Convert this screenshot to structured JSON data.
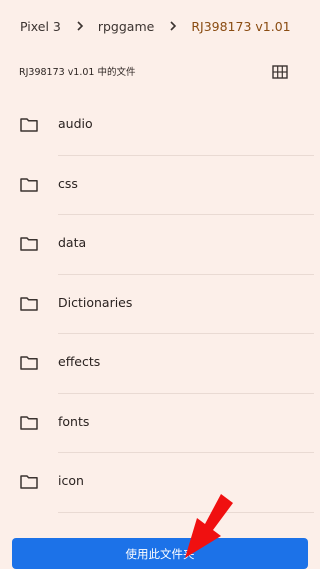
{
  "breadcrumb": {
    "items": [
      {
        "label": "Pixel 3"
      },
      {
        "label": "rpggame"
      },
      {
        "label": "RJ398173 v1.01"
      }
    ],
    "separator_icon": "chevron-right-icon",
    "current_color": "#8a4c12"
  },
  "subheader": {
    "title": "RJ398173 v1.01 中的文件",
    "view_toggle_icon": "grid-view-icon"
  },
  "folders": [
    {
      "label": "audio"
    },
    {
      "label": "css"
    },
    {
      "label": "data"
    },
    {
      "label": "Dictionaries"
    },
    {
      "label": "effects"
    },
    {
      "label": "fonts"
    },
    {
      "label": "icon"
    }
  ],
  "folder_icon": "folder-icon",
  "action": {
    "use_folder_label": "使用此文件夹",
    "button_color": "#1c72e8"
  },
  "annotation": {
    "arrow_icon": "red-arrow-icon",
    "arrow_color": "#f01010"
  },
  "colors": {
    "background": "#fcefe9",
    "divider": "#e9dad3"
  }
}
